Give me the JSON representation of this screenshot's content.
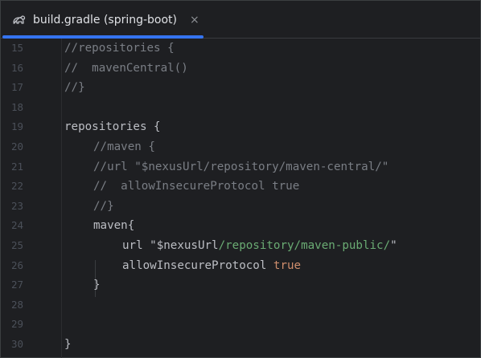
{
  "tab": {
    "title": "build.gradle (spring-boot)",
    "close_glyph": "×",
    "icon": "gradle-elephant-icon"
  },
  "colors": {
    "background": "#1e1f22",
    "accent": "#3574f0",
    "comment": "#7a7e85",
    "keyword": "#cf8e6d",
    "string": "#6aab73",
    "text": "#bcbec4",
    "line_number": "#4b5059"
  },
  "line_numbers": [
    "15",
    "16",
    "17",
    "18",
    "19",
    "20",
    "21",
    "22",
    "23",
    "24",
    "25",
    "26",
    "27",
    "28",
    "29",
    "30"
  ],
  "code": {
    "l15": "//repositories {",
    "l16": "//  mavenCentral()",
    "l17": "//}",
    "l19_a": "repositories",
    "l19_b": " {",
    "l20": "//maven {",
    "l21": "//url \"$nexusUrl/repository/maven-central/\"",
    "l22": "//  allowInsecureProtocol true",
    "l23": "//}",
    "l24": "maven{",
    "l25_a": "url ",
    "l25_b": "\"$nexusUrl",
    "l25_c": "/repository/maven-public/",
    "l25_d": "\"",
    "l26_a": "allowInsecureProtocol ",
    "l26_b": "true",
    "l27": "}",
    "l30": "}"
  }
}
